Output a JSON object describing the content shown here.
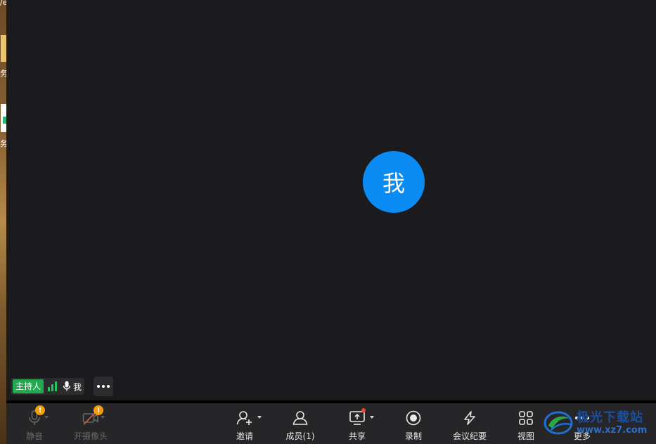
{
  "desktop": {
    "top_text": "/e",
    "label1": "务",
    "label2": "务"
  },
  "avatar": {
    "text": "我"
  },
  "nameplate": {
    "host_tag": "主持人",
    "name": "我"
  },
  "toolbar": {
    "mute": "静音",
    "camera": "开摄像头",
    "invite": "邀请",
    "members": "成员(1)",
    "share": "共享",
    "record": "录制",
    "minutes": "会议纪要",
    "view": "视图",
    "more": "更多"
  },
  "watermark": {
    "title": "极光下载站",
    "url": "www.xz7.com"
  },
  "colors": {
    "accent": "#0b8cf5",
    "host": "#1faa50",
    "warn": "#f59e0b",
    "background": "#1b1b1d",
    "toolbar": "#262628"
  }
}
